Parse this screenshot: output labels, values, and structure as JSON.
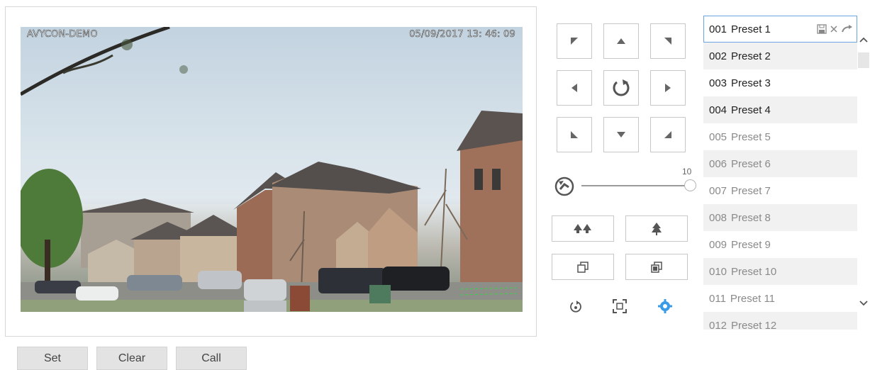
{
  "video": {
    "osd_name": "AVYCON-DEMO",
    "osd_datetime": "05/09/2017 13: 46: 09"
  },
  "ptz": {
    "icons": {
      "up_left": "arrow-up-left-icon",
      "up": "arrow-up-icon",
      "up_right": "arrow-up-right-icon",
      "left": "arrow-left-icon",
      "center": "rotate-icon",
      "right": "arrow-right-icon",
      "down_left": "arrow-down-left-icon",
      "down": "arrow-down-icon",
      "down_right": "arrow-down-right-icon"
    },
    "speed": {
      "value": "10",
      "max": 10
    }
  },
  "presets": {
    "items": [
      {
        "num": "001",
        "name": "Preset 1",
        "state": "set"
      },
      {
        "num": "002",
        "name": "Preset 2",
        "state": "set"
      },
      {
        "num": "003",
        "name": "Preset 3",
        "state": "set"
      },
      {
        "num": "004",
        "name": "Preset 4",
        "state": "set"
      },
      {
        "num": "005",
        "name": "Preset 5",
        "state": "unset"
      },
      {
        "num": "006",
        "name": "Preset 6",
        "state": "unset"
      },
      {
        "num": "007",
        "name": "Preset 7",
        "state": "unset"
      },
      {
        "num": "008",
        "name": "Preset 8",
        "state": "unset"
      },
      {
        "num": "009",
        "name": "Preset 9",
        "state": "unset"
      },
      {
        "num": "010",
        "name": "Preset 10",
        "state": "unset"
      },
      {
        "num": "011",
        "name": "Preset 11",
        "state": "unset"
      },
      {
        "num": "012",
        "name": "Preset 12",
        "state": "unset"
      }
    ]
  },
  "actions": {
    "set_label": "Set",
    "clear_label": "Clear",
    "call_label": "Call"
  },
  "colors": {
    "selected_border": "#6aa3e0",
    "active_icon": "#3a9be6",
    "set_text": "#222222",
    "unset_text": "#8a8a8a"
  }
}
